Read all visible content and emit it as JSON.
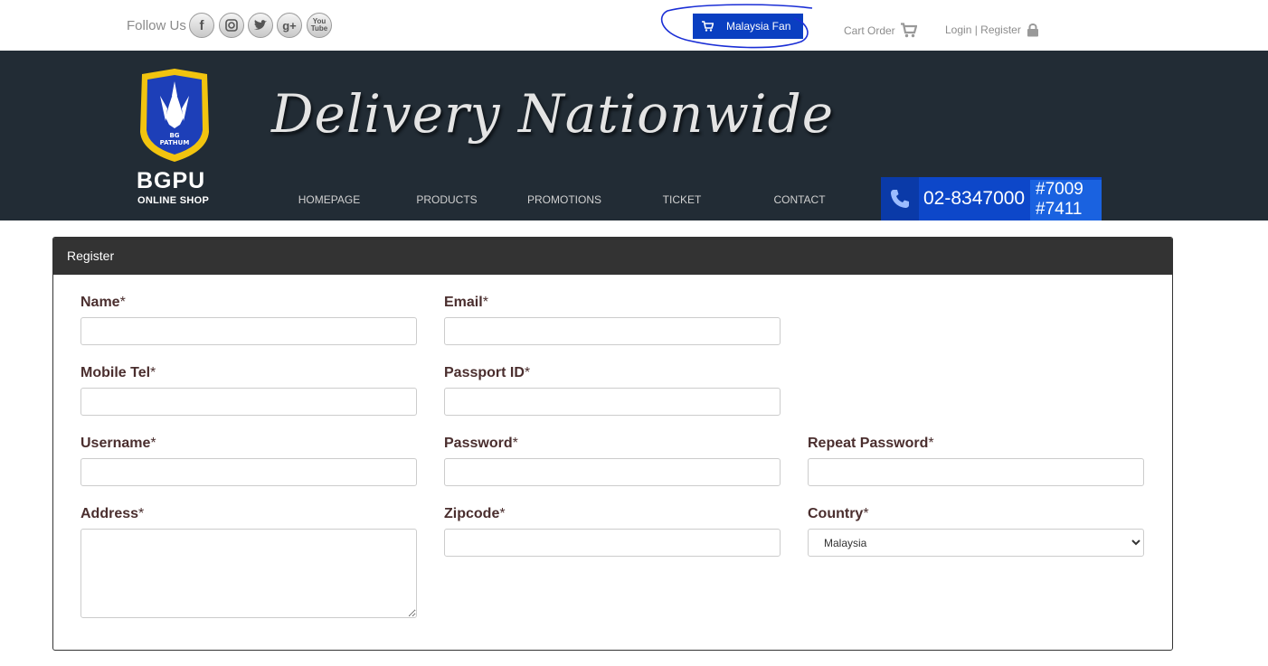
{
  "topbar": {
    "follow_label": "Follow Us",
    "social_icons": [
      "facebook-icon",
      "instagram-icon",
      "twitter-icon",
      "google-plus-icon",
      "youtube-icon"
    ],
    "fan_button": "Malaysia Fan",
    "cart_order": "Cart Order",
    "login_register": "Login | Register"
  },
  "banner": {
    "logo_text": "BG PATHUM",
    "brand": "BGPU",
    "brand_sub": "ONLINE SHOP",
    "tagline": "Delivery Nationwide",
    "nav": [
      "HOMEPAGE",
      "PRODUCTS",
      "PROMOTIONS",
      "TICKET",
      "CONTACT"
    ],
    "phone": "02-8347000",
    "ext1": "#7009",
    "ext2": "#7411"
  },
  "form": {
    "title": "Register",
    "required_mark": "*",
    "labels": {
      "name": "Name",
      "email": "Email",
      "mobile": "Mobile Tel",
      "passport": "Passport ID",
      "username": "Username",
      "password": "Password",
      "repeat_password": "Repeat Password",
      "address": "Address",
      "zipcode": "Zipcode",
      "country": "Country"
    },
    "country_selected": "Malaysia"
  },
  "colors": {
    "banner_bg": "#222c35",
    "fan_button": "#0a3fc1",
    "phone_box": "#0d47c9",
    "panel_header": "#333333",
    "label_text": "#4a2e2e"
  }
}
